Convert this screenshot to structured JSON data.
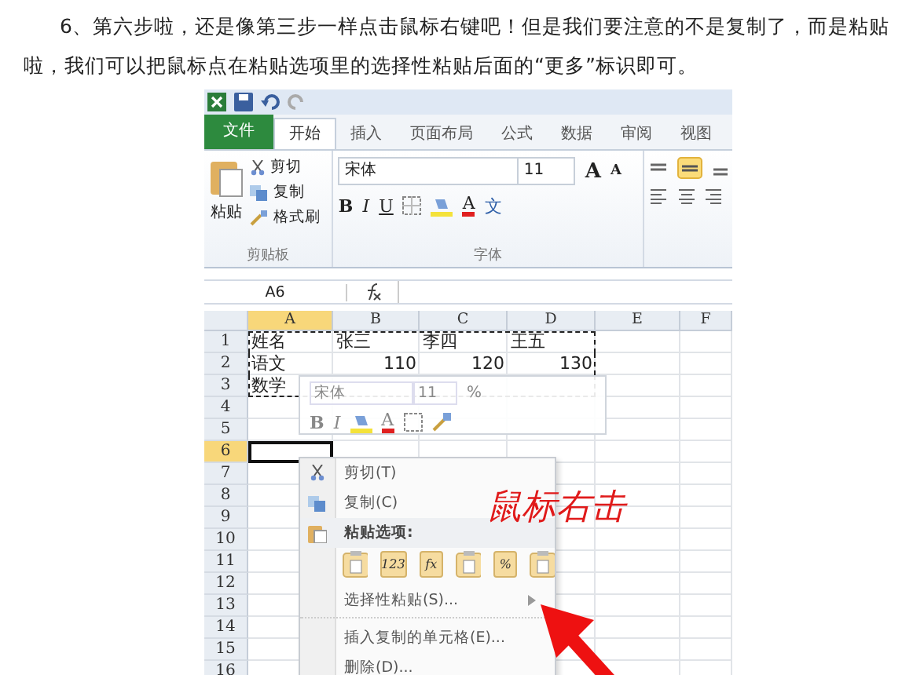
{
  "article": {
    "paragraph": "6、第六步啦，还是像第三步一样点击鼠标右键吧！但是我们要注意的不是复制了，而是粘贴啦，我们可以把鼠标点在粘贴选项里的选择性粘贴后面的“更多”标识即可。"
  },
  "excel": {
    "tabs": [
      {
        "label": "文件",
        "kind": "file",
        "selected": false
      },
      {
        "label": "开始",
        "kind": "tab",
        "selected": true
      },
      {
        "label": "插入",
        "kind": "tab",
        "selected": false
      },
      {
        "label": "页面布局",
        "kind": "tab",
        "selected": false
      },
      {
        "label": "公式",
        "kind": "tab",
        "selected": false
      },
      {
        "label": "数据",
        "kind": "tab",
        "selected": false
      },
      {
        "label": "审阅",
        "kind": "tab",
        "selected": false
      },
      {
        "label": "视图",
        "kind": "tab",
        "selected": false
      }
    ],
    "clipboard": {
      "paste": "粘贴",
      "cut": "剪切",
      "copy": "复制",
      "format_painter": "格式刷",
      "label": "剪贴板"
    },
    "font": {
      "name": "宋体",
      "size": "11",
      "bold": "B",
      "italic": "I",
      "underline": "U",
      "grow": "A",
      "shrink": "A",
      "color_button": "A",
      "phonetic": "文",
      "label": "字体"
    },
    "name_box": "A6",
    "columns": [
      {
        "label": "A",
        "selected": true
      },
      {
        "label": "B",
        "selected": false
      },
      {
        "label": "C",
        "selected": false
      },
      {
        "label": "D",
        "selected": false
      },
      {
        "label": "E",
        "selected": false
      },
      {
        "label": "F",
        "selected": false
      }
    ],
    "rows": [
      {
        "header": "1",
        "selected": false,
        "copied": true,
        "cells": [
          {
            "text": "姓名",
            "kind": "text"
          },
          {
            "text": "张三",
            "kind": "text"
          },
          {
            "text": "李四",
            "kind": "text"
          },
          {
            "text": "王五",
            "kind": "text"
          }
        ]
      },
      {
        "header": "2",
        "selected": false,
        "copied": true,
        "cells": [
          {
            "text": "语文",
            "kind": "text"
          },
          {
            "text": "110",
            "kind": "number"
          },
          {
            "text": "120",
            "kind": "number"
          },
          {
            "text": "130",
            "kind": "number"
          }
        ]
      },
      {
        "header": "3",
        "selected": false,
        "copied": true,
        "cells": [
          {
            "text": "数学",
            "kind": "text"
          }
        ]
      },
      {
        "header": "4",
        "selected": false,
        "copied": false
      },
      {
        "header": "5",
        "selected": false,
        "copied": false
      },
      {
        "header": "6",
        "selected": true,
        "copied": false
      },
      {
        "header": "7",
        "selected": false,
        "copied": false
      },
      {
        "header": "8",
        "selected": false,
        "copied": false
      },
      {
        "header": "9",
        "selected": false,
        "copied": false
      },
      {
        "header": "10",
        "selected": false,
        "copied": false
      },
      {
        "header": "11",
        "selected": false,
        "copied": false
      },
      {
        "header": "12",
        "selected": false,
        "copied": false
      },
      {
        "header": "13",
        "selected": false,
        "copied": false
      },
      {
        "header": "14",
        "selected": false,
        "copied": false
      },
      {
        "header": "15",
        "selected": false,
        "copied": false
      },
      {
        "header": "16",
        "selected": false,
        "copied": false
      }
    ],
    "mini_toolbar": {
      "font": "宋体",
      "size": "11",
      "percent": "%",
      "bold": "B",
      "italic": "I",
      "color_button": "A"
    },
    "context_menu": [
      {
        "kind": "cut",
        "label": "剪切(T)"
      },
      {
        "kind": "copy",
        "label": "复制(C)"
      },
      {
        "kind": "header",
        "label": "粘贴选项:"
      },
      {
        "kind": "paste_icons",
        "icons": [
          {
            "kind": "blank"
          },
          {
            "kind": "text",
            "text": "123"
          },
          {
            "kind": "text",
            "text": "fx"
          },
          {
            "kind": "blank"
          },
          {
            "kind": "text",
            "text": "%"
          },
          {
            "kind": "blank"
          }
        ]
      },
      {
        "kind": "submenu",
        "label": "选择性粘贴(S)..."
      },
      {
        "kind": "item",
        "label": "插入复制的单元格(E)..."
      },
      {
        "kind": "item",
        "label": "删除(D)..."
      }
    ],
    "annotation": {
      "text": "鼠标右击"
    }
  }
}
